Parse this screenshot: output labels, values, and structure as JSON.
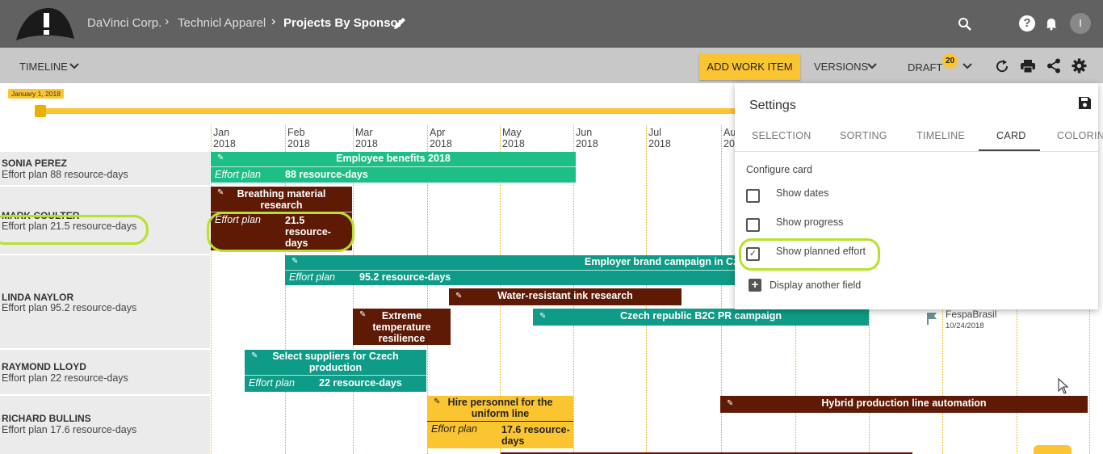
{
  "header": {
    "breadcrumbs": [
      "DaVinci Corp.",
      "Technicl Apparel"
    ],
    "current": "Projects By Sponsor",
    "icons": [
      "logo-hat",
      "pencil-icon",
      "search-icon",
      "help-icon",
      "bell-icon",
      "avatar"
    ],
    "avatar_initial": "I"
  },
  "toolbar": {
    "timeline_label": "TIMELINE",
    "add_work_item": "ADD WORK ITEM",
    "versions": "VERSIONS",
    "draft": "DRAFT",
    "draft_count": "20"
  },
  "timeline": {
    "slider_label": "January 1, 2018",
    "months": [
      {
        "m": "Jan",
        "y": "2018"
      },
      {
        "m": "Feb",
        "y": "2018"
      },
      {
        "m": "Mar",
        "y": "2018"
      },
      {
        "m": "Apr",
        "y": "2018"
      },
      {
        "m": "May",
        "y": "2018"
      },
      {
        "m": "Jun",
        "y": "2018"
      },
      {
        "m": "Jul",
        "y": "2018"
      },
      {
        "m": "Au",
        "y": "20"
      }
    ]
  },
  "rows": [
    {
      "name": "SONIA PEREZ",
      "effort": "Effort plan 88 resource-days"
    },
    {
      "name": "MARK COULTER",
      "effort": "Effort plan 21.5 resource-days"
    },
    {
      "name": "LINDA NAYLOR",
      "effort": "Effort plan 95.2 resource-days"
    },
    {
      "name": "RAYMOND LLOYD",
      "effort": "Effort plan 22 resource-days"
    },
    {
      "name": "RICHARD BULLINS",
      "effort": "Effort plan 17.6 resource-days"
    }
  ],
  "bars": {
    "b1": {
      "title": "Employee benefits 2018",
      "plan": "Effort plan",
      "value": "88 resource-days"
    },
    "b2": {
      "title": "Breathing material research",
      "plan": "Effort plan",
      "value": "21.5 resource-days"
    },
    "b3": {
      "title": "Employer brand campaign in Cze",
      "plan": "Effort plan",
      "value": "95.2 resource-days"
    },
    "b4": {
      "title": "Water-resistant ink research"
    },
    "b5": {
      "title": "Extreme temperature resilience"
    },
    "b6": {
      "title": "Czech republic B2C PR campaign"
    },
    "b7": {
      "title": "Select suppliers for Czech production",
      "plan": "Effort plan",
      "value": "22 resource-days"
    },
    "b8": {
      "title": "Hire personnel for the uniform line",
      "plan": "Effort plan",
      "value": "17.6 resource-days"
    },
    "b9": {
      "title": "Hybrid production line automation"
    }
  },
  "milestone": {
    "name": "FespaBrasil",
    "date": "10/24/2018"
  },
  "settings": {
    "title": "Settings",
    "tabs": [
      "SELECTION",
      "SORTING",
      "TIMELINE",
      "CARD",
      "COLORIN"
    ],
    "active_tab": "CARD",
    "section": "Configure card",
    "options": [
      {
        "label": "Show dates",
        "checked": false
      },
      {
        "label": "Show progress",
        "checked": false
      },
      {
        "label": "Show planned effort",
        "checked": true
      }
    ],
    "add_field": "Display another field"
  },
  "colors": {
    "green": "#1dbf86",
    "teal": "#0e9b87",
    "brown": "#5e1a05",
    "yellow": "#fbc531",
    "highlight": "#b7e12b"
  }
}
